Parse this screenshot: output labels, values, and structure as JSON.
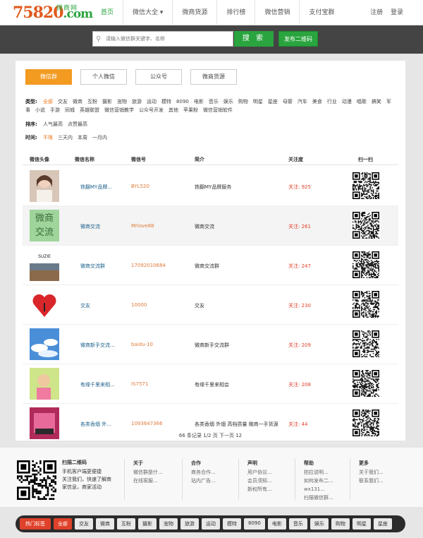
{
  "logo": {
    "num": "75820",
    "dom": ".com",
    "cn": "微商网"
  },
  "nav": [
    "首页",
    "微信大全 ▾",
    "微商货源",
    "排行榜",
    "微信营销",
    "支付宝群"
  ],
  "login": [
    "注册",
    "登录"
  ],
  "search": {
    "placeholder": "请输入微信群关键字、名称",
    "button": "搜 索",
    "qr_button": "发布二维码"
  },
  "tabs": [
    "微信群",
    "个人微信",
    "公众号",
    "微商货源"
  ],
  "filters": {
    "type_label": "类型:",
    "types": [
      "全部",
      "交友",
      "微商",
      "互粉",
      "摄影",
      "宠物",
      "旅游",
      "运动",
      "模特",
      "8090",
      "电影",
      "音乐",
      "娱乐",
      "购物",
      "明星",
      "星座",
      "母婴",
      "汽车",
      "美食",
      "行业",
      "动漫",
      "唱歌",
      "搞笑",
      "军事",
      "小说",
      "手游",
      "同城",
      "英雄联盟",
      "微信营销教学",
      "公众号开发",
      "其他",
      "苹果粉",
      "微信营销软件"
    ],
    "sort_label": "排序:",
    "sorts": [
      "人气最高",
      "点赞最高"
    ],
    "time_label": "时间:",
    "times": [
      "不限",
      "三天内",
      "本周",
      "一月内"
    ]
  },
  "table": {
    "headers": [
      "微信头像",
      "微信名称",
      "微信号",
      "简介",
      "关注度",
      "扫一扫"
    ],
    "follow_label": "关注:",
    "rows": [
      {
        "name": "铁翻MY品牌...",
        "wx": "BYL520",
        "desc": "铁翻MY品牌服务",
        "follow": "925"
      },
      {
        "name": "微商交流",
        "wx": "Mrlove88",
        "desc": "微商交流",
        "follow": "261"
      },
      {
        "name": "微商交流群",
        "wx": "17092010684",
        "desc": "微商交流群",
        "follow": "247"
      },
      {
        "name": "交友",
        "wx": "10000",
        "desc": "交友",
        "follow": "230"
      },
      {
        "name": "微商新手交流...",
        "wx": "baidu-10",
        "desc": "微商新手交流群",
        "follow": "209"
      },
      {
        "name": "有缘千里来相...",
        "wx": "IS7571",
        "desc": "有缘千里来相会",
        "follow": "208"
      },
      {
        "name": "各类香烟 外...",
        "wx": "1093647366",
        "desc": "各类香烟 外烟 高档质量 微商一手货源",
        "follow": "44"
      }
    ]
  },
  "avatar_text": "微商\n交流",
  "pager": "66 条记录 1/2 页 下一页 12",
  "footer": {
    "intro_title": "扫描二维码",
    "intro": [
      "手机客户端更便捷",
      "关注我们，快速了解商",
      "家信息，商家活动"
    ],
    "cols": [
      {
        "title": "关于",
        "items": [
          "微信群是什...",
          "在线客服..."
        ]
      },
      {
        "title": "合作",
        "items": [
          "商务合作...",
          "站内广告..."
        ]
      },
      {
        "title": "声明",
        "items": [
          "用户协议...",
          "会员须知...",
          "新权所有..."
        ]
      },
      {
        "title": "帮助",
        "items": [
          "拍拉说明...",
          "如何发布二...",
          "wx131...",
          "扫描微信群..."
        ]
      },
      {
        "title": "更多",
        "items": [
          "关于我们...",
          "联系我们..."
        ]
      }
    ]
  },
  "hot": {
    "label": "热门标签",
    "tags": [
      "全部",
      "交友",
      "微商",
      "互粉",
      "摄影",
      "宠物",
      "旅游",
      "运动",
      "模特",
      "8090",
      "电影",
      "音乐",
      "娱乐",
      "购物",
      "明星",
      "星座"
    ]
  },
  "colors": {
    "green": "#2aa43e",
    "orange": "#f39a21",
    "red": "#e0412a"
  }
}
